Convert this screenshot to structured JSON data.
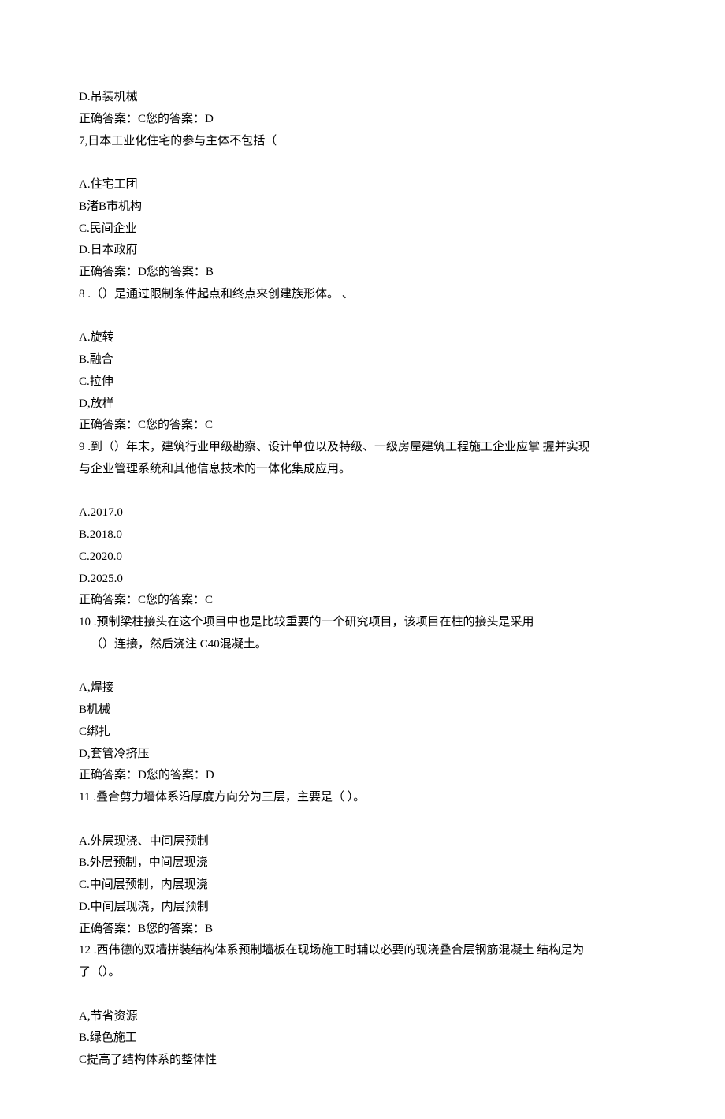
{
  "q6": {
    "optD": "D.吊装机械",
    "ans": "正确答案：C您的答案：D"
  },
  "q7": {
    "stem": "7,日本工业化住宅的参与主体不包括（",
    "optA": "A.住宅工团",
    "optB": "B渚B市机构",
    "optC": "C.民间企业",
    "optD": "D.日本政府",
    "ans": "正确答案：D您的答案：B"
  },
  "q8": {
    "stem": "8 .（）是通过限制条件起点和终点来创建族形体。    、",
    "optA": "A.旋转",
    "optB": "B.融合",
    "optC": "C.拉伸",
    "optD": "D,放样",
    "ans": "正确答案：C您的答案：C"
  },
  "q9": {
    "stem1": "9 .到（）年末，建筑行业甲级勘察、设计单位以及特级、一级房屋建筑工程施工企业应掌 握并实现",
    "stem2": "与企业管理系统和其他信息技术的一体化集成应用。",
    "optA": "A.2017.0",
    "optB": "B.2018.0",
    "optC": "C.2020.0",
    "optD": "D.2025.0",
    "ans": "正确答案：C您的答案：C"
  },
  "q10": {
    "stem1": "10 .预制梁柱接头在这个项目中也是比较重要的一个研究项目，该项目在柱的接头是采用",
    "stem2": "（）连接，然后浇注 C40混凝土。",
    "optA": "A,焊接",
    "optB": "B机械",
    "optC": "C绑扎",
    "optD": "D,套管冷挤压",
    "ans": "正确答案：D您的答案：D"
  },
  "q11": {
    "stem": "11 .叠合剪力墙体系沿厚度方向分为三层，主要是（    ）。",
    "optA": "A.外层现浇、中间层预制",
    "optB": "B.外层预制，中间层现浇",
    "optC": "C.中间层预制，内层现浇",
    "optD": "D.中间层现浇，内层预制",
    "ans": "正确答案：B您的答案：B"
  },
  "q12": {
    "stem1": "12 .西伟德的双墙拼装结构体系预制墙板在现场施工时辅以必要的现浇叠合层钢筋混凝土 结构是为",
    "stem2": "了（）。",
    "optA": "A,节省资源",
    "optB": "B.绿色施工",
    "optC": "C提高了结构体系的整体性"
  }
}
